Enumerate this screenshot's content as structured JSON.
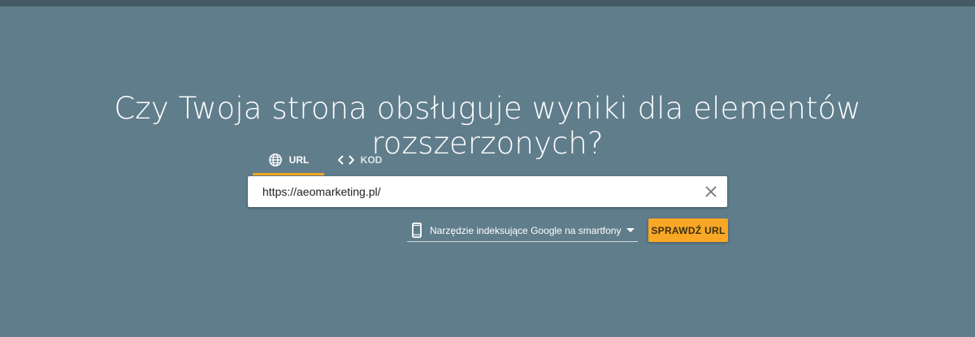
{
  "headline": "Czy Twoja strona obsługuje wyniki dla elementów rozszerzonych?",
  "tabs": [
    {
      "label": "URL",
      "icon": "globe-icon",
      "active": true
    },
    {
      "label": "KOD",
      "icon": "code-icon",
      "active": false
    }
  ],
  "url_input": {
    "value": "https://aeomarketing.pl/"
  },
  "user_agent": {
    "label": "Narzędzie indeksujące Google na smartfony",
    "icon": "smartphone-icon"
  },
  "check_button": {
    "label": "SPRAWDŹ URL"
  },
  "colors": {
    "background": "#607d8b",
    "top_bar": "#455a64",
    "accent": "#f9a825",
    "tab_indicator": "#f5a623"
  }
}
